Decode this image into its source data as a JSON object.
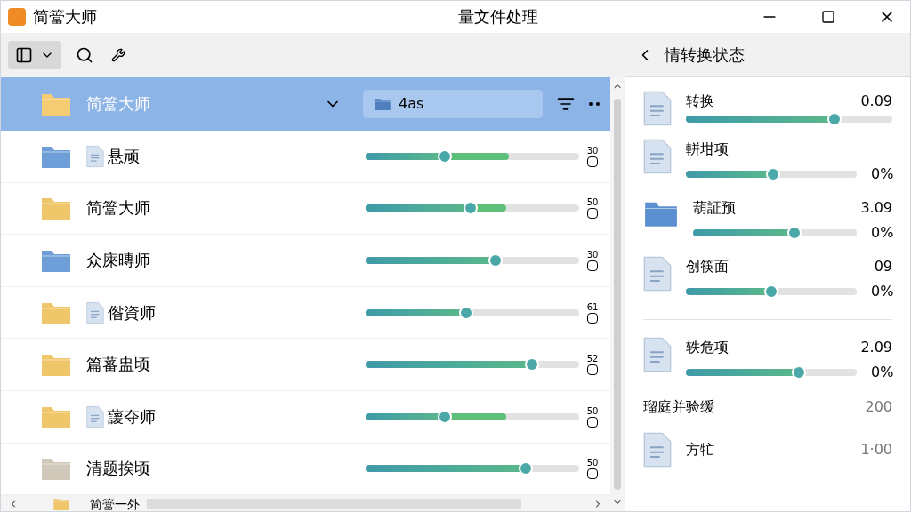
{
  "window": {
    "app_name": "简簹大师",
    "title": "量文件处理"
  },
  "toolbar": {
    "view_button_selected": true
  },
  "header": {
    "folder_name": "简簹大师",
    "path_chip": "4as"
  },
  "rows": [
    {
      "name": "悬顽",
      "color": "#6f9fd8",
      "doc_icon": true,
      "level": 0.37,
      "secondary": {
        "level": 0.67
      },
      "count": "30",
      "checked": false
    },
    {
      "name": "简簹大师",
      "color": "#f0c66a",
      "doc_icon": false,
      "level": 0.49,
      "secondary": {
        "level": 0.66
      },
      "count": "50",
      "checked": false
    },
    {
      "name": "众庲暷师",
      "color": "#6f9fd8",
      "doc_icon": false,
      "level": 0.61,
      "count": "30",
      "checked": false
    },
    {
      "name": "偺資师",
      "color": "#f0c66a",
      "doc_icon": true,
      "level": 0.47,
      "count": "61",
      "checked": false
    },
    {
      "name": "篇蕃盅顷",
      "color": "#f0c66a",
      "doc_icon": false,
      "level": 0.78,
      "count": "52",
      "checked": false
    },
    {
      "name": "蘐夺师",
      "color": "#f0c66a",
      "doc_icon": true,
      "level": 0.37,
      "secondary": {
        "level": 0.66
      },
      "count": "50",
      "checked": false
    },
    {
      "name": "清题挨顷",
      "color": "#cfc8b8",
      "doc_icon": false,
      "level": 0.75,
      "count": "50",
      "checked": false
    }
  ],
  "partial_row": {
    "name": "简簹一外"
  },
  "side_panel": {
    "title": "情转换状态",
    "items": [
      {
        "kind": "progress",
        "name": "转换",
        "value": "0.09",
        "level": 0.72
      },
      {
        "kind": "progress",
        "name": "軿坩项",
        "percent": "0%",
        "level": 0.51
      },
      {
        "kind": "progress",
        "name": "葫証预",
        "value": "3.09",
        "percent": "0%",
        "level": 0.62
      },
      {
        "kind": "progress",
        "name": "创筷面",
        "value": "09",
        "percent": "0%",
        "level": 0.5
      },
      {
        "kind": "divider"
      },
      {
        "kind": "progress",
        "name": "轶危项",
        "value": "2.09",
        "percent": "0%",
        "level": 0.66
      },
      {
        "kind": "stat",
        "name": "瑠庭并验缓",
        "value": "200"
      },
      {
        "kind": "stat",
        "name": "方牤",
        "value": "1·00"
      }
    ]
  }
}
